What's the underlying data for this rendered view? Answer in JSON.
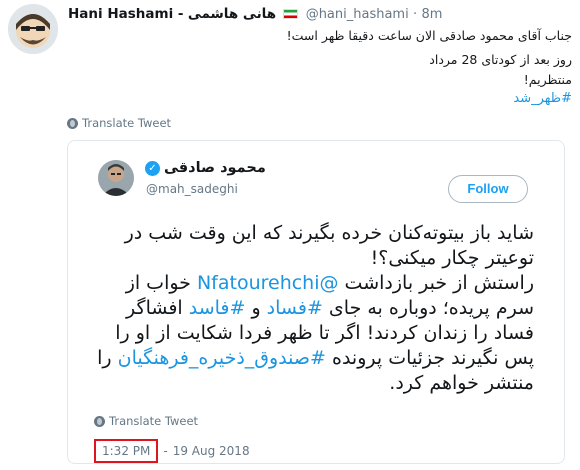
{
  "tweet": {
    "name": "Hani Hashami -",
    "name_fa": "هانی هاشمی",
    "handle": "@hani_hashami",
    "time_sep": "·",
    "time": "8m",
    "lines": [
      "جناب آقای محمود صادقی الان ساعت دقیقا ظهر است!",
      "روز بعد از کودتای 28 مرداد",
      "منتظریم!"
    ],
    "hashtag": "#ظهر_شد",
    "translate_label": "Translate Tweet"
  },
  "quoted": {
    "name": "محمود صادقی",
    "verified_badge": "✓",
    "handle": "@mah_sadeghi",
    "follow_label": "Follow",
    "body_a": "شاید باز بیتوته‌کنان خرده بگیرند که این وقت شب در توعیتر چکار میکنی؟!",
    "body_b1": "راستش از خبر بازداشت ",
    "mention": "@Nfatourehchi",
    "body_b2": " خواب از سرم پریده؛ دوباره به جای ",
    "tag1": "#فساد",
    "body_b3": " و ",
    "tag2": "#فاسد",
    "body_b4": " افشاگر فساد را زندان کردند! اگر تا ظهر فردا شکایت از او را پس نگیرند جزئیات پرونده ",
    "tag3": "#صندوق_ذخیره_فرهنگیان",
    "body_b5": " را منتشر خواهم کرد.",
    "translate_label": "Translate Tweet",
    "time": "1:32 PM",
    "date_sep": "-",
    "date": "19 Aug 2018"
  },
  "colors": {
    "link": "#1b95e0",
    "highlight_box": "#e0141e",
    "verified": "#1da1f2"
  },
  "icons": [
    "globe-icon",
    "verified-icon",
    "iran-flag-icon"
  ]
}
